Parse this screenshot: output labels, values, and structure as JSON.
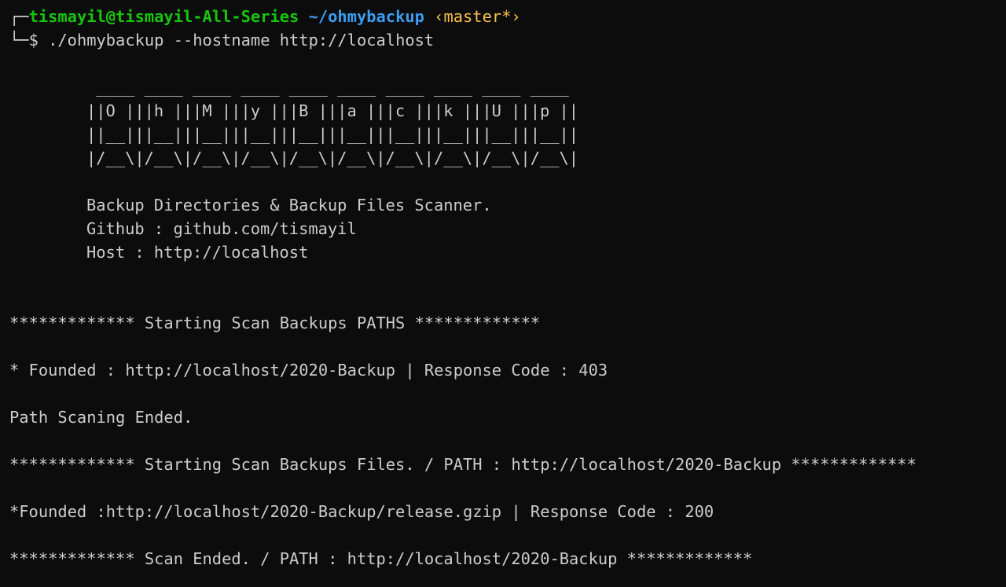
{
  "prompt": {
    "frame_top": "┌─",
    "user_host": "tismayil@tismayil-All-Series",
    "cwd": "~/ohmybackup",
    "git_branch": "‹master*›",
    "frame_bottom": "└─",
    "symbol": "$",
    "command": "./ohmybackup --hostname http://localhost"
  },
  "banner": {
    "ascii_art": [
      " ____ ____ ____ ____ ____ ____ ____ ____ ____ ____ ",
      "||O |||h |||M |||y |||B |||a |||c |||k |||U |||p ||",
      "||__|||__|||__|||__|||__|||__|||__|||__|||__|||__||",
      "|/__\\|/__\\|/__\\|/__\\|/__\\|/__\\|/__\\|/__\\|/__\\|/__\\|"
    ],
    "description": "Backup Directories & Backup Files Scanner.",
    "github": "Github : github.com/tismayil",
    "host": "Host : http://localhost"
  },
  "output": {
    "start_paths": "************* Starting Scan Backups PATHS *************",
    "found_path": "* Founded : http://localhost/2020-Backup | Response Code : 403",
    "path_ended": "Path Scaning Ended.",
    "start_files": "************* Starting Scan Backups Files. / PATH : http://localhost/2020-Backup *************",
    "found_file": "*Founded :http://localhost/2020-Backup/release.gzip | Response Code : 200",
    "scan_ended": "************* Scan Ended. / PATH : http://localhost/2020-Backup *************"
  },
  "colors": {
    "background": "#0c0c0c",
    "foreground": "#cccccc",
    "user_host": "#16c60c",
    "cwd": "#3b9cf0",
    "git_branch": "#f9c14a"
  }
}
